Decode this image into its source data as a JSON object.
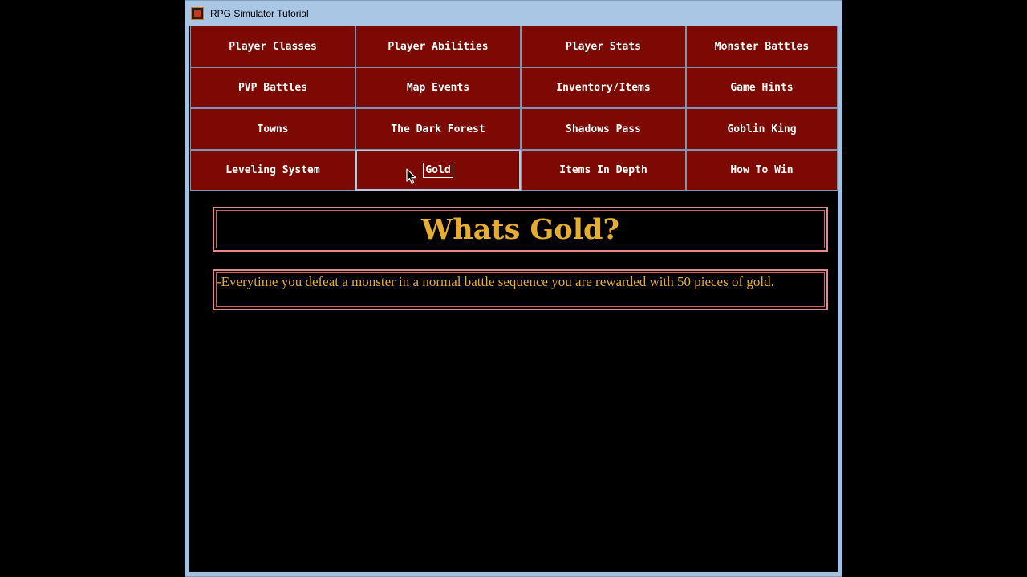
{
  "window": {
    "title": "RPG Simulator Tutorial",
    "icon": "rpg-app-icon"
  },
  "nav": {
    "buttons": [
      {
        "label": "Player Classes"
      },
      {
        "label": "Player Abilities"
      },
      {
        "label": "Player Stats"
      },
      {
        "label": "Monster Battles"
      },
      {
        "label": "PVP Battles"
      },
      {
        "label": "Map Events"
      },
      {
        "label": "Inventory/Items"
      },
      {
        "label": "Game Hints"
      },
      {
        "label": "Towns"
      },
      {
        "label": "The Dark Forest"
      },
      {
        "label": "Shadows Pass"
      },
      {
        "label": "Goblin King"
      },
      {
        "label": "Leveling System"
      },
      {
        "label": "Gold",
        "selected": true
      },
      {
        "label": "Items In Depth"
      },
      {
        "label": "How To Win"
      }
    ]
  },
  "content": {
    "heading": "Whats Gold?",
    "body": "-Everytime you defeat a monster in a normal battle sequence you are rewarded with 50 pieces of gold."
  },
  "colors": {
    "button_bg": "#7c0a02",
    "text_gold": "#e6ad2e",
    "panel_border": "#e58a8a",
    "background": "#000000"
  }
}
